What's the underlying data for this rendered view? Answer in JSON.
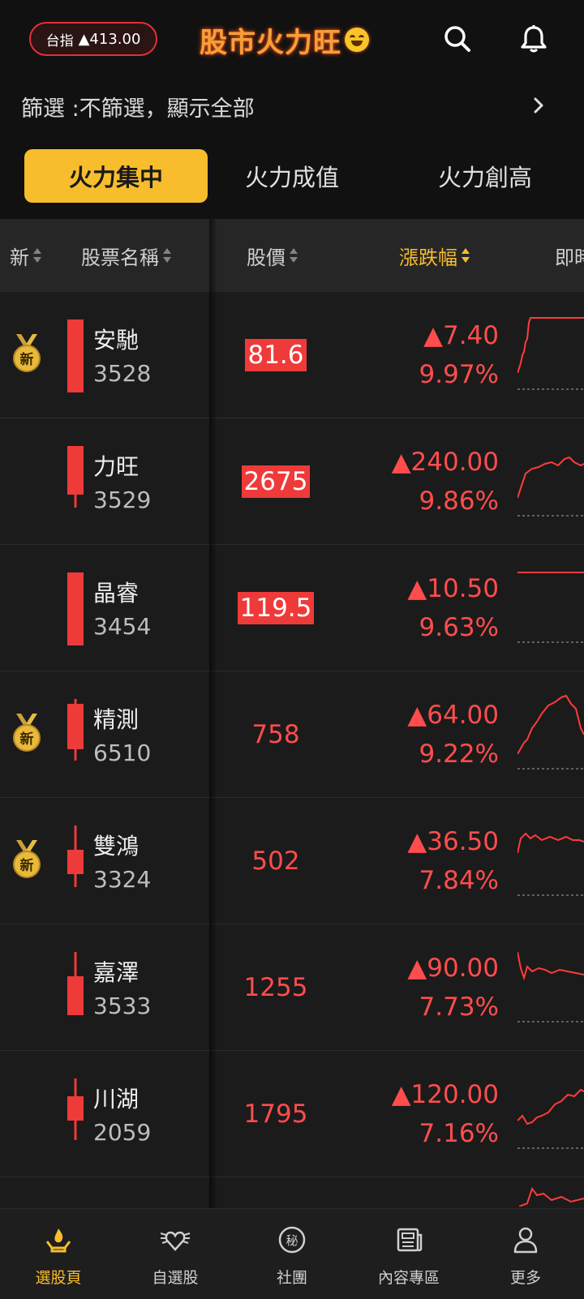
{
  "header": {
    "index_label": "台指",
    "index_value": "▲413.00",
    "app_title": "股市火力旺",
    "search_icon": "search-icon",
    "bell_icon": "bell-icon"
  },
  "filter": {
    "text": "篩選 :不篩選，顯示全部"
  },
  "tabs": [
    {
      "label": "火力集中",
      "active": true
    },
    {
      "label": "火力成值",
      "active": false
    },
    {
      "label": "火力創高",
      "active": false
    }
  ],
  "columns": {
    "new": "新",
    "name": "股票名稱",
    "price": "股價",
    "change": "漲跌幅",
    "realtime": "即時"
  },
  "stocks": [
    {
      "new": true,
      "name": "安馳",
      "code": "3528",
      "price": "81.6",
      "price_highlight": true,
      "change": "▲7.40",
      "pct": "9.97%"
    },
    {
      "new": false,
      "name": "力旺",
      "code": "3529",
      "price": "2675",
      "price_highlight": true,
      "change": "▲240.00",
      "pct": "9.86%"
    },
    {
      "new": false,
      "name": "晶睿",
      "code": "3454",
      "price": "119.5",
      "price_highlight": true,
      "change": "▲10.50",
      "pct": "9.63%"
    },
    {
      "new": true,
      "name": "精測",
      "code": "6510",
      "price": "758",
      "price_highlight": false,
      "change": "▲64.00",
      "pct": "9.22%"
    },
    {
      "new": true,
      "name": "雙鴻",
      "code": "3324",
      "price": "502",
      "price_highlight": false,
      "change": "▲36.50",
      "pct": "7.84%"
    },
    {
      "new": false,
      "name": "嘉澤",
      "code": "3533",
      "price": "1255",
      "price_highlight": false,
      "change": "▲90.00",
      "pct": "7.73%"
    },
    {
      "new": false,
      "name": "川湖",
      "code": "2059",
      "price": "1795",
      "price_highlight": false,
      "change": "▲120.00",
      "pct": "7.16%"
    }
  ],
  "new_badge_text": "新",
  "nav": [
    {
      "label": "選股頁",
      "icon": "flame-hand-icon",
      "active": true
    },
    {
      "label": "自選股",
      "icon": "winged-heart-icon",
      "active": false
    },
    {
      "label": "社團",
      "icon": "secret-badge-icon",
      "active": false
    },
    {
      "label": "內容專區",
      "icon": "newspaper-icon",
      "active": false
    },
    {
      "label": "更多",
      "icon": "person-icon",
      "active": false
    }
  ],
  "colors": {
    "up": "#ff4d4d",
    "accent": "#f7bd2c",
    "background": "#111111"
  }
}
